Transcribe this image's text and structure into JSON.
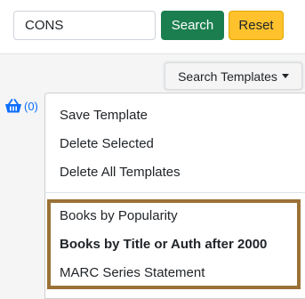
{
  "search": {
    "value": "CONS"
  },
  "buttons": {
    "search_label": "Search",
    "reset_label": "Reset"
  },
  "templates_button": {
    "label": "Search Templates"
  },
  "basket": {
    "count": "(0)"
  },
  "menu": {
    "actions": [
      "Save Template",
      "Delete Selected",
      "Delete All Templates"
    ],
    "templates": [
      "Books by Popularity",
      "Books by Title or Auth after 2000",
      "MARC Series Statement"
    ],
    "selected_template": "Books by Title or Auth after 2000"
  },
  "colors": {
    "search_button": "#1b7e4f",
    "reset_button": "#ffc22d",
    "highlight_border": "#9b7136",
    "basket_icon": "#0d6efd"
  },
  "icons": {
    "basket": "basket-icon",
    "dropdown": "caret-down-icon"
  }
}
